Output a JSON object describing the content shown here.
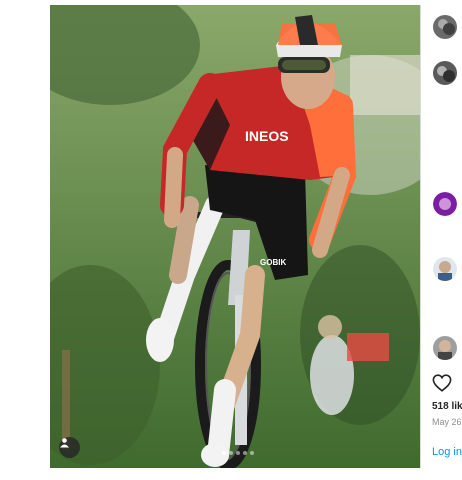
{
  "post": {
    "jersey_text": "INEOS",
    "shorts_text": "GOBIK",
    "carousel": {
      "slides": 5,
      "active": 0
    }
  },
  "sidebar": {
    "likes": "518 lik",
    "date": "May 26",
    "login": "Log in"
  },
  "colors": {
    "jersey_red": "#c62828",
    "jersey_orange": "#ff6f3c",
    "link_blue": "#0095f6"
  },
  "icons": [
    "chevron-right-icon",
    "user-tag-icon",
    "heart-icon"
  ]
}
